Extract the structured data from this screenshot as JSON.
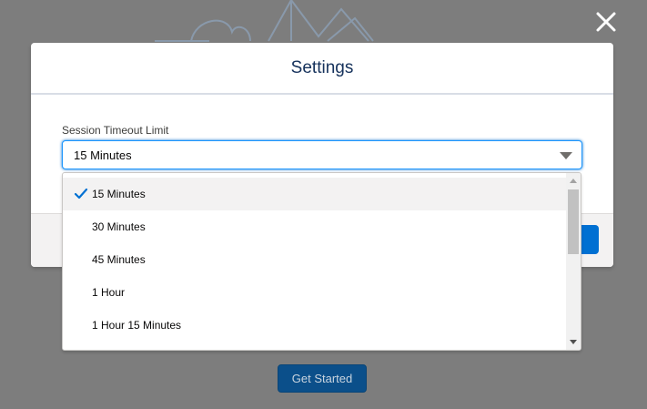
{
  "modal": {
    "title": "Settings",
    "field_label": "Session Timeout Limit",
    "selected_value": "15 Minutes"
  },
  "dropdown": {
    "options": [
      {
        "label": "15 Minutes",
        "selected": true
      },
      {
        "label": "30 Minutes",
        "selected": false
      },
      {
        "label": "45 Minutes",
        "selected": false
      },
      {
        "label": "1 Hour",
        "selected": false
      },
      {
        "label": "1 Hour 15 Minutes",
        "selected": false
      }
    ]
  },
  "background": {
    "get_started_label": "Get Started"
  },
  "icons": {
    "close": "close-icon",
    "caret": "chevron-down-icon",
    "check": "check-icon"
  },
  "colors": {
    "overlay": "#7d7d7d",
    "accent": "#0070d2",
    "check": "#0070d2",
    "title": "#16325c"
  }
}
